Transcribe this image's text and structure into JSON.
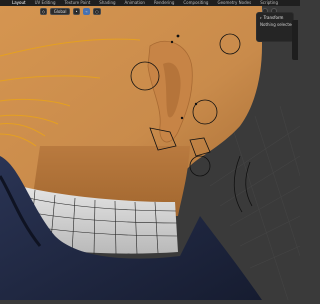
{
  "app": {
    "menu_tabs": [
      {
        "label": "Layout"
      },
      {
        "label": "UV Editing"
      },
      {
        "label": "Texture Paint"
      },
      {
        "label": "Shading"
      },
      {
        "label": "Animation"
      },
      {
        "label": "Rendering"
      },
      {
        "label": "Compositing"
      },
      {
        "label": "Geometry Nodes"
      },
      {
        "label": "Scripting"
      }
    ],
    "active_tab_index": 0,
    "toolbar": {
      "orientation_label": "Global"
    }
  },
  "operator_panel": {
    "title": "Transform",
    "option_label": "Nothing selected"
  },
  "colors": {
    "skin": "#c98b4b",
    "collar": "#d6d6d6",
    "jacket": "#1f2740",
    "background": "#3a3a3a",
    "hair_strands": "#e8a21c",
    "selection_accent": "#4772b3"
  },
  "icons": [
    "chevron-down-icon",
    "checkbox-icon",
    "camera-wireframe-icon",
    "empty-circle-icon"
  ]
}
